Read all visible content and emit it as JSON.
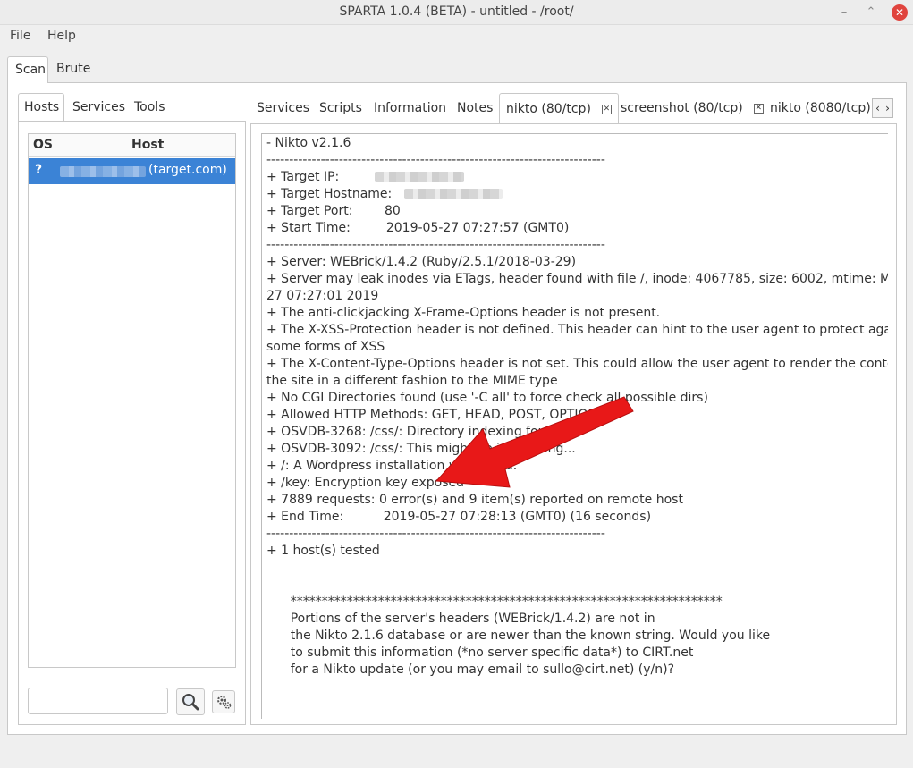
{
  "window": {
    "title": "SPARTA 1.0.4 (BETA) - untitled - /root/",
    "minimize": "–",
    "maximize": "⌃",
    "close": "✕"
  },
  "menu": {
    "file": "File",
    "help": "Help"
  },
  "top_tabs": {
    "scan": "Scan",
    "brute": "Brute"
  },
  "left_tabs": {
    "hosts": "Hosts",
    "services": "Services",
    "tools": "Tools"
  },
  "hosts_table": {
    "col_os": "OS",
    "col_host": "Host",
    "rows": [
      {
        "os": "?",
        "host": "(target.com)"
      }
    ]
  },
  "right_tabs": {
    "services": "Services",
    "scripts": "Scripts",
    "information": "Information",
    "notes": "Notes",
    "nikto80": "nikto (80/tcp)",
    "screenshot80": "screenshot (80/tcp)",
    "nikto8080": "nikto (8080/tcp)",
    "close_glyph": "✕",
    "scroll_left": "‹",
    "scroll_right": "›"
  },
  "output": {
    "lines": [
      "- Nikto v2.1.6",
      "---------------------------------------------------------------------------",
      "+ Target IP:",
      "+ Target Hostname:",
      "+ Target Port:        80",
      "+ Start Time:         2019-05-27 07:27:57 (GMT0)",
      "---------------------------------------------------------------------------",
      "+ Server: WEBrick/1.4.2 (Ruby/2.5.1/2018-03-29)",
      "+ Server may leak inodes via ETags, header found with file /, inode: 4067785, size: 6002, mtime: Mon May",
      "27 07:27:01 2019",
      "+ The anti-clickjacking X-Frame-Options header is not present.",
      "+ The X-XSS-Protection header is not defined. This header can hint to the user agent to protect against",
      "some forms of XSS",
      "+ The X-Content-Type-Options header is not set. This could allow the user agent to render the content of",
      "the site in a different fashion to the MIME type",
      "+ No CGI Directories found (use '-C all' to force check all possible dirs)",
      "+ Allowed HTTP Methods: GET, HEAD, POST, OPTIONS",
      "+ OSVDB-3268: /css/: Directory indexing found.",
      "+ OSVDB-3092: /css/: This might be interesting...",
      "+ /: A Wordpress installation was found.",
      "+ /key: Encryption key exposed",
      "+ 7889 requests: 0 error(s) and 9 item(s) reported on remote host",
      "+ End Time:          2019-05-27 07:28:13 (GMT0) (16 seconds)",
      "---------------------------------------------------------------------------",
      "+ 1 host(s) tested",
      "",
      "",
      "      *********************************************************************",
      "      Portions of the server's headers (WEBrick/1.4.2) are not in",
      "      the Nikto 2.1.6 database or are newer than the known string. Would you like",
      "      to submit this information (*no server specific data*) to CIRT.net",
      "      for a Nikto update (or you may email to sullo@cirt.net) (y/n)?"
    ]
  },
  "colors": {
    "selection": "#3b83d6",
    "annotation_arrow": "#e81818"
  },
  "icons": {
    "search": "search-icon",
    "gear": "gear-icon",
    "close": "close-icon"
  }
}
